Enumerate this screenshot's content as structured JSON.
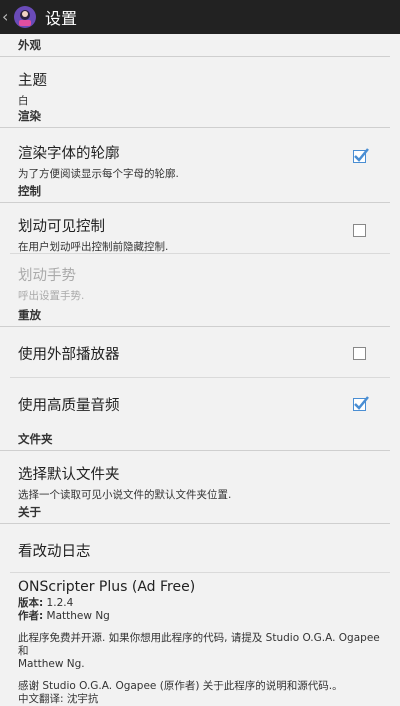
{
  "actionbar": {
    "title": "设置"
  },
  "sections": {
    "appearance": {
      "header": "外观",
      "theme": {
        "title": "主题",
        "summary": "白"
      }
    },
    "render": {
      "header": "渲染",
      "outline": {
        "title": "渲染字体的轮廓",
        "summary": "为了方便阅读显示每个字母的轮廓.",
        "checked": true
      }
    },
    "control": {
      "header": "控制",
      "swipe": {
        "title": "划动可见控制",
        "summary": "在用户划动呼出控制前隐藏控制.",
        "checked": false
      },
      "gesture": {
        "title": "划动手势",
        "summary": "呼出设置手势."
      }
    },
    "playback": {
      "header": "重放",
      "external": {
        "title": "使用外部播放器",
        "checked": false
      },
      "hq_audio": {
        "title": "使用高质量音频",
        "checked": true
      }
    },
    "folder": {
      "header": "文件夹",
      "default_folder": {
        "title": "选择默认文件夹",
        "summary": "选择一个读取可见小说文件的默认文件夹位置."
      }
    },
    "about": {
      "header": "关于",
      "changelog": {
        "title": "看改动日志"
      },
      "app_name": "ONScripter Plus (Ad Free)",
      "version_label": "版本:",
      "version_value": "1.2.4",
      "author_label": "作者:",
      "author_value": "Matthew Ng",
      "free_line1": "此程序免费并开源. 如果你想用此程序的代码, 请提及 Studio O.G.A. Ogapee 和",
      "free_line2": "Matthew Ng.",
      "thanks_line": "感谢 Studio O.G.A. Ogapee (原作者) 关于此程序的说明和源代码.。",
      "translator_label": "中文翻译:",
      "translator_value": "沈宇抗"
    }
  },
  "colors": {
    "actionbar_bg": "#222222",
    "checkbox_accent": "#4a8ed3",
    "background": "#f2f2f2"
  }
}
